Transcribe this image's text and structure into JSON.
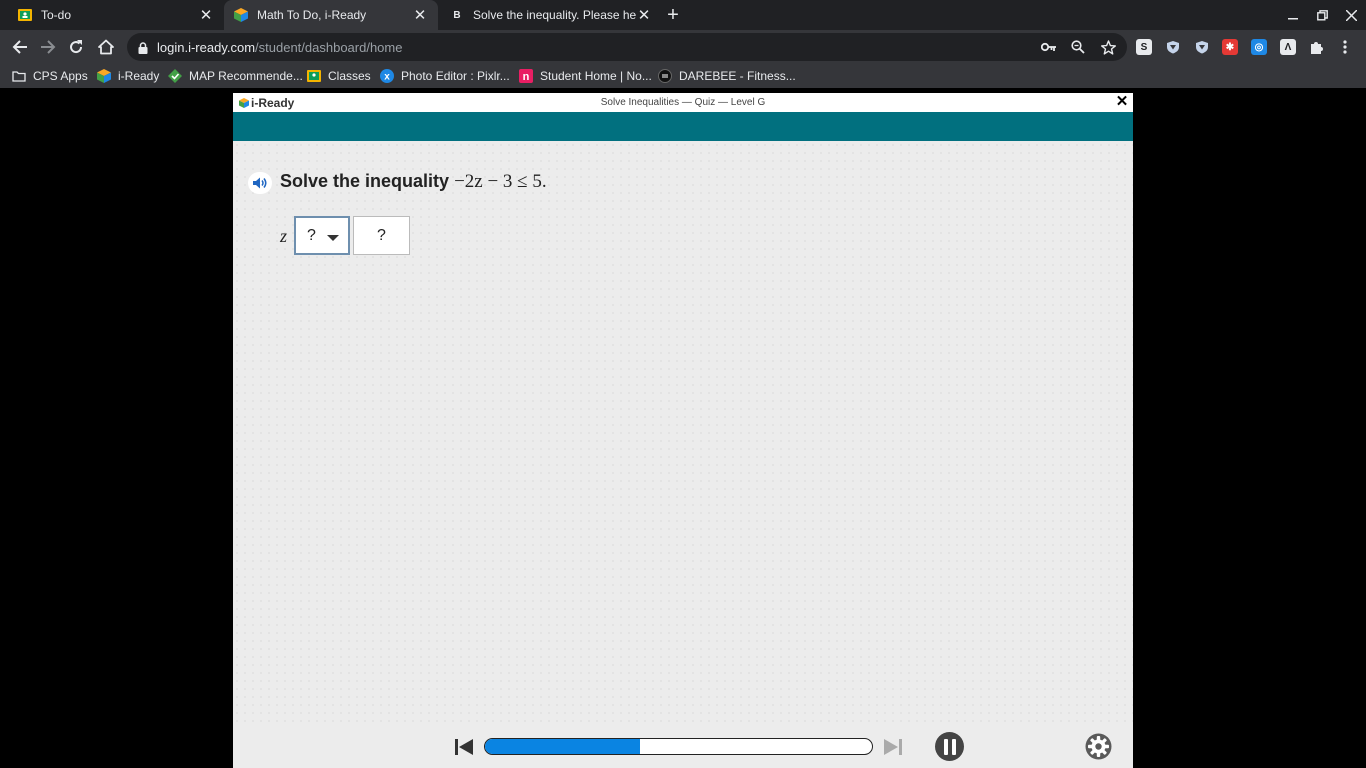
{
  "browser": {
    "tabs": [
      {
        "title": "To-do",
        "icon": "classroom-icon",
        "active": false
      },
      {
        "title": "Math To Do, i-Ready",
        "icon": "iready-cube-icon",
        "active": true
      },
      {
        "title": "Solve the inequality. Please help",
        "icon": "brainly-icon",
        "active": false
      }
    ],
    "url_host": "login.i-ready.com",
    "url_path": "/student/dashboard/home",
    "bookmarks": [
      {
        "label": "CPS Apps",
        "icon": "folder-icon"
      },
      {
        "label": "i-Ready",
        "icon": "iready-cube-icon"
      },
      {
        "label": "MAP Recommende...",
        "icon": "map-icon"
      },
      {
        "label": "Classes",
        "icon": "classroom-icon"
      },
      {
        "label": "Photo Editor : Pixlr...",
        "icon": "pixlr-icon"
      },
      {
        "label": "Student Home | No...",
        "icon": "noredink-icon"
      },
      {
        "label": "DAREBEE - Fitness...",
        "icon": "darebee-icon"
      }
    ]
  },
  "app": {
    "logo_text": "i-Ready",
    "quiz_title": "Solve Inequalities — Quiz — Level G",
    "question_prefix": "Solve the inequality",
    "question_math": "−2z − 3 ≤ 5.",
    "variable": "z",
    "dropdown_value": "?",
    "answer_value": "?",
    "progress": 0.4,
    "colors": {
      "header_band": "#01707f",
      "progress_fill": "#0a84e2"
    }
  }
}
